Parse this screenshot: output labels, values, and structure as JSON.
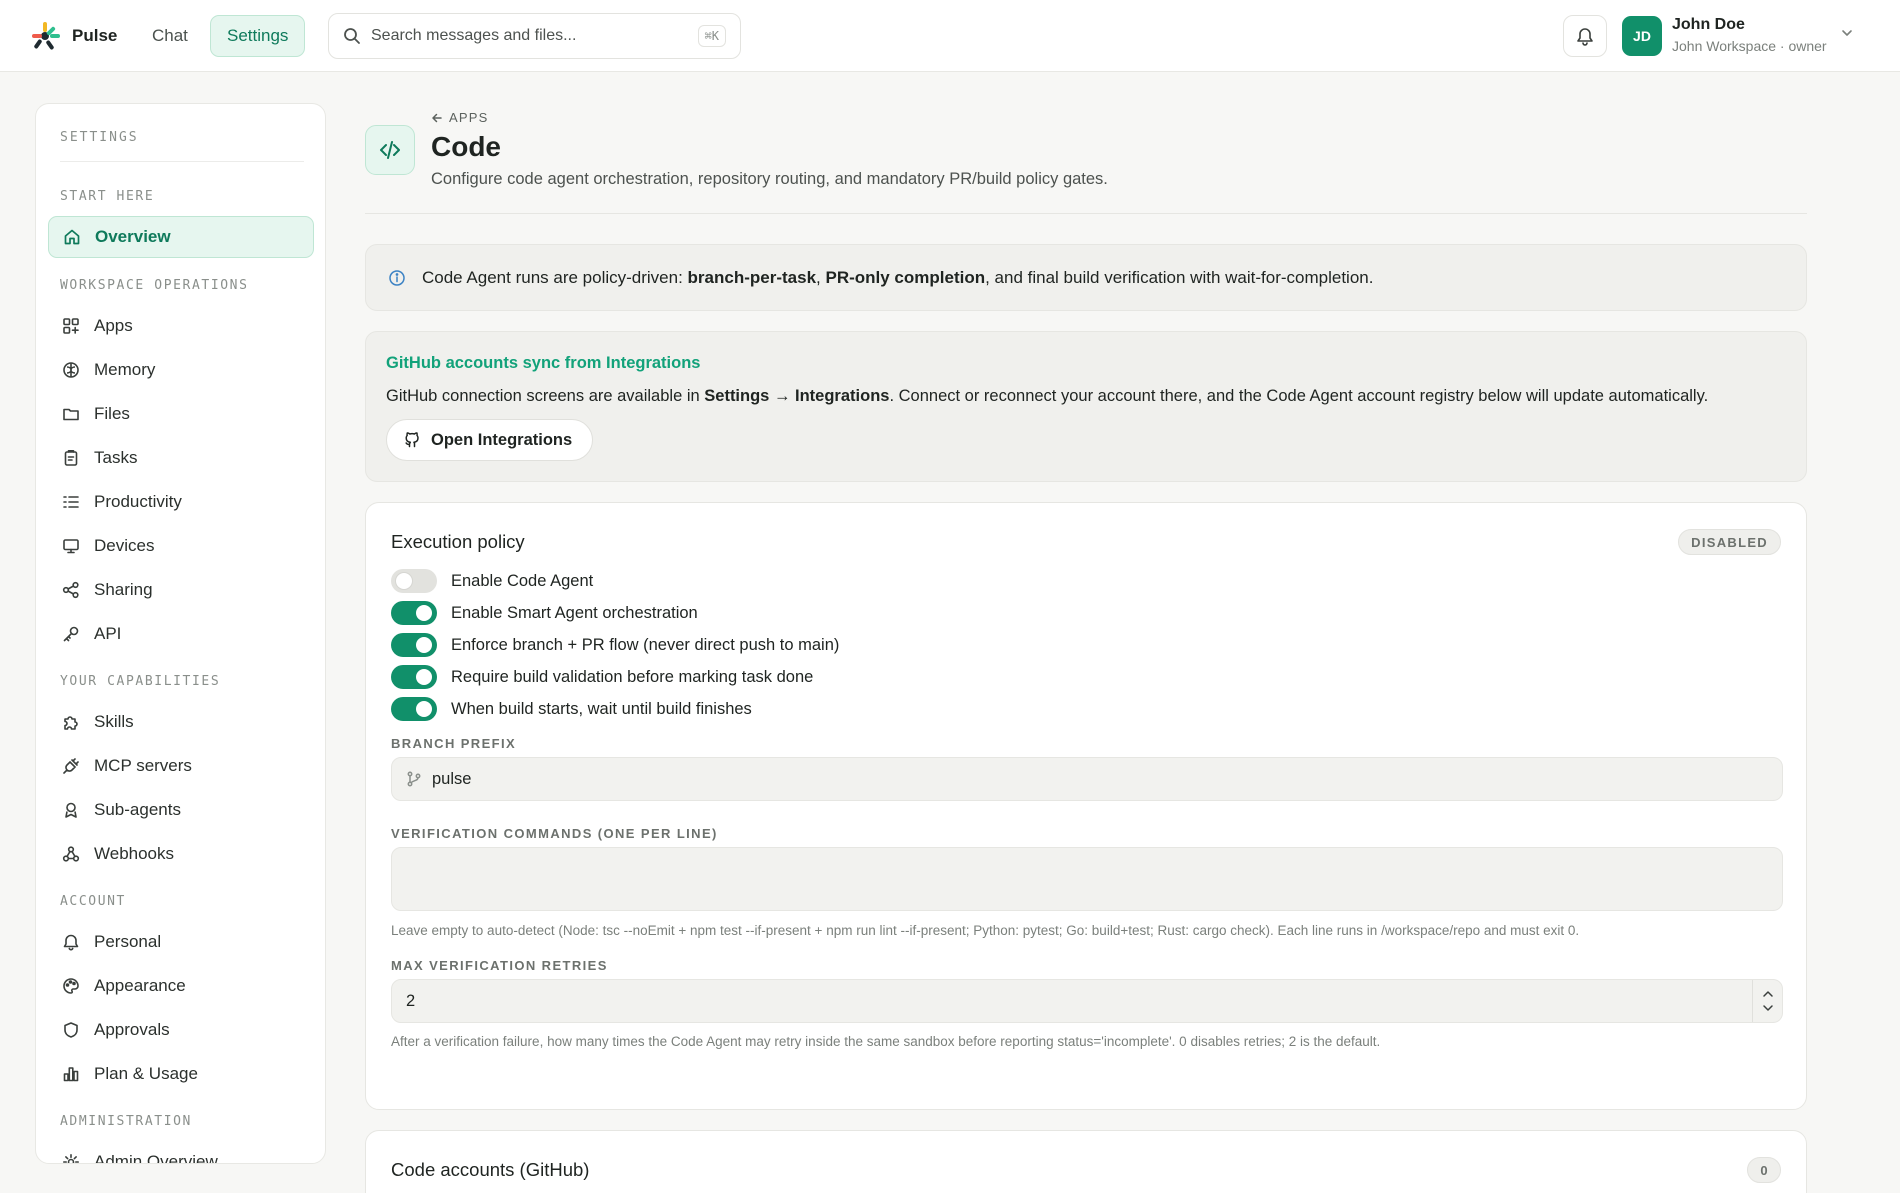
{
  "header": {
    "brand": "Pulse",
    "nav": {
      "chat": "Chat",
      "settings": "Settings"
    },
    "search": {
      "placeholder": "Search messages and files...",
      "shortcut": "⌘K"
    },
    "user": {
      "initials": "JD",
      "name": "John Doe",
      "subtitle": "John Workspace · owner"
    }
  },
  "sidebar": {
    "title": "SETTINGS",
    "sections": {
      "start": "START HERE",
      "workspace": "WORKSPACE OPERATIONS",
      "capabilities": "YOUR CAPABILITIES",
      "account": "ACCOUNT",
      "administration": "ADMINISTRATION"
    },
    "items": {
      "overview": "Overview",
      "apps": "Apps",
      "memory": "Memory",
      "files": "Files",
      "tasks": "Tasks",
      "productivity": "Productivity",
      "devices": "Devices",
      "sharing": "Sharing",
      "api": "API",
      "skills": "Skills",
      "mcp": "MCP servers",
      "subagents": "Sub-agents",
      "webhooks": "Webhooks",
      "personal": "Personal",
      "appearance": "Appearance",
      "approvals": "Approvals",
      "plan": "Plan & Usage",
      "admin_overview": "Admin Overview"
    }
  },
  "page": {
    "back": "APPS",
    "title": "Code",
    "subtitle": "Configure code agent orchestration, repository routing, and mandatory PR/build policy gates.",
    "info": {
      "prefix": "Code Agent runs are policy-driven: ",
      "bold1": "branch-per-task",
      "sep": ", ",
      "bold2": "PR-only completion",
      "suffix": ", and final build verification with wait-for-completion."
    },
    "sync": {
      "title": "GitHub accounts sync from Integrations",
      "text_prefix": "GitHub connection screens are available in ",
      "text_bold": "Settings → Integrations",
      "text_suffix": ". Connect or reconnect your account there, and the Code Agent account registry below will update automatically.",
      "button": "Open Integrations"
    },
    "policy": {
      "title": "Execution policy",
      "status": "DISABLED",
      "toggles": {
        "enable_code_agent": {
          "label": "Enable Code Agent",
          "on": false
        },
        "smart_agent": {
          "label": "Enable Smart Agent orchestration",
          "on": true
        },
        "branch_pr": {
          "label": "Enforce branch + PR flow (never direct push to main)",
          "on": true
        },
        "build_validation": {
          "label": "Require build validation before marking task done",
          "on": true
        },
        "wait_build": {
          "label": "When build starts, wait until build finishes",
          "on": true
        }
      },
      "branch_prefix": {
        "label": "BRANCH PREFIX",
        "value": "pulse"
      },
      "verification": {
        "label": "VERIFICATION COMMANDS (ONE PER LINE)",
        "value": "",
        "help": "Leave empty to auto-detect (Node: tsc --noEmit + npm test --if-present + npm run lint --if-present; Python: pytest; Go: build+test; Rust: cargo check). Each line runs in /workspace/repo and must exit 0."
      },
      "retries": {
        "label": "MAX VERIFICATION RETRIES",
        "value": "2",
        "help": "After a verification failure, how many times the Code Agent may retry inside the same sandbox before reporting status='incomplete'. 0 disables retries; 2 is the default."
      }
    },
    "accounts": {
      "title": "Code accounts (GitHub)",
      "count": "0"
    }
  },
  "colors": {
    "accent": "#11906a",
    "accent_bg": "#e6f6ef",
    "sync_title": "#12a27a",
    "info_icon": "#3b82c4"
  }
}
